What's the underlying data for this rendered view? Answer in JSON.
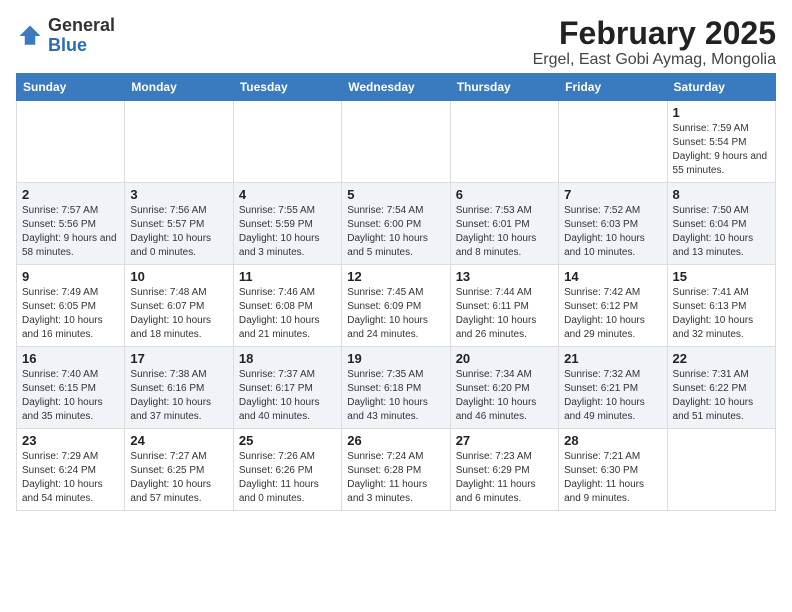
{
  "header": {
    "logo_general": "General",
    "logo_blue": "Blue",
    "month_title": "February 2025",
    "subtitle": "Ergel, East Gobi Aymag, Mongolia"
  },
  "days_of_week": [
    "Sunday",
    "Monday",
    "Tuesday",
    "Wednesday",
    "Thursday",
    "Friday",
    "Saturday"
  ],
  "weeks": [
    [
      {
        "day": "",
        "info": ""
      },
      {
        "day": "",
        "info": ""
      },
      {
        "day": "",
        "info": ""
      },
      {
        "day": "",
        "info": ""
      },
      {
        "day": "",
        "info": ""
      },
      {
        "day": "",
        "info": ""
      },
      {
        "day": "1",
        "info": "Sunrise: 7:59 AM\nSunset: 5:54 PM\nDaylight: 9 hours\nand 55 minutes."
      }
    ],
    [
      {
        "day": "2",
        "info": "Sunrise: 7:57 AM\nSunset: 5:56 PM\nDaylight: 9 hours\nand 58 minutes."
      },
      {
        "day": "3",
        "info": "Sunrise: 7:56 AM\nSunset: 5:57 PM\nDaylight: 10 hours\nand 0 minutes."
      },
      {
        "day": "4",
        "info": "Sunrise: 7:55 AM\nSunset: 5:59 PM\nDaylight: 10 hours\nand 3 minutes."
      },
      {
        "day": "5",
        "info": "Sunrise: 7:54 AM\nSunset: 6:00 PM\nDaylight: 10 hours\nand 5 minutes."
      },
      {
        "day": "6",
        "info": "Sunrise: 7:53 AM\nSunset: 6:01 PM\nDaylight: 10 hours\nand 8 minutes."
      },
      {
        "day": "7",
        "info": "Sunrise: 7:52 AM\nSunset: 6:03 PM\nDaylight: 10 hours\nand 10 minutes."
      },
      {
        "day": "8",
        "info": "Sunrise: 7:50 AM\nSunset: 6:04 PM\nDaylight: 10 hours\nand 13 minutes."
      }
    ],
    [
      {
        "day": "9",
        "info": "Sunrise: 7:49 AM\nSunset: 6:05 PM\nDaylight: 10 hours\nand 16 minutes."
      },
      {
        "day": "10",
        "info": "Sunrise: 7:48 AM\nSunset: 6:07 PM\nDaylight: 10 hours\nand 18 minutes."
      },
      {
        "day": "11",
        "info": "Sunrise: 7:46 AM\nSunset: 6:08 PM\nDaylight: 10 hours\nand 21 minutes."
      },
      {
        "day": "12",
        "info": "Sunrise: 7:45 AM\nSunset: 6:09 PM\nDaylight: 10 hours\nand 24 minutes."
      },
      {
        "day": "13",
        "info": "Sunrise: 7:44 AM\nSunset: 6:11 PM\nDaylight: 10 hours\nand 26 minutes."
      },
      {
        "day": "14",
        "info": "Sunrise: 7:42 AM\nSunset: 6:12 PM\nDaylight: 10 hours\nand 29 minutes."
      },
      {
        "day": "15",
        "info": "Sunrise: 7:41 AM\nSunset: 6:13 PM\nDaylight: 10 hours\nand 32 minutes."
      }
    ],
    [
      {
        "day": "16",
        "info": "Sunrise: 7:40 AM\nSunset: 6:15 PM\nDaylight: 10 hours\nand 35 minutes."
      },
      {
        "day": "17",
        "info": "Sunrise: 7:38 AM\nSunset: 6:16 PM\nDaylight: 10 hours\nand 37 minutes."
      },
      {
        "day": "18",
        "info": "Sunrise: 7:37 AM\nSunset: 6:17 PM\nDaylight: 10 hours\nand 40 minutes."
      },
      {
        "day": "19",
        "info": "Sunrise: 7:35 AM\nSunset: 6:18 PM\nDaylight: 10 hours\nand 43 minutes."
      },
      {
        "day": "20",
        "info": "Sunrise: 7:34 AM\nSunset: 6:20 PM\nDaylight: 10 hours\nand 46 minutes."
      },
      {
        "day": "21",
        "info": "Sunrise: 7:32 AM\nSunset: 6:21 PM\nDaylight: 10 hours\nand 49 minutes."
      },
      {
        "day": "22",
        "info": "Sunrise: 7:31 AM\nSunset: 6:22 PM\nDaylight: 10 hours\nand 51 minutes."
      }
    ],
    [
      {
        "day": "23",
        "info": "Sunrise: 7:29 AM\nSunset: 6:24 PM\nDaylight: 10 hours\nand 54 minutes."
      },
      {
        "day": "24",
        "info": "Sunrise: 7:27 AM\nSunset: 6:25 PM\nDaylight: 10 hours\nand 57 minutes."
      },
      {
        "day": "25",
        "info": "Sunrise: 7:26 AM\nSunset: 6:26 PM\nDaylight: 11 hours\nand 0 minutes."
      },
      {
        "day": "26",
        "info": "Sunrise: 7:24 AM\nSunset: 6:28 PM\nDaylight: 11 hours\nand 3 minutes."
      },
      {
        "day": "27",
        "info": "Sunrise: 7:23 AM\nSunset: 6:29 PM\nDaylight: 11 hours\nand 6 minutes."
      },
      {
        "day": "28",
        "info": "Sunrise: 7:21 AM\nSunset: 6:30 PM\nDaylight: 11 hours\nand 9 minutes."
      },
      {
        "day": "",
        "info": ""
      }
    ]
  ]
}
